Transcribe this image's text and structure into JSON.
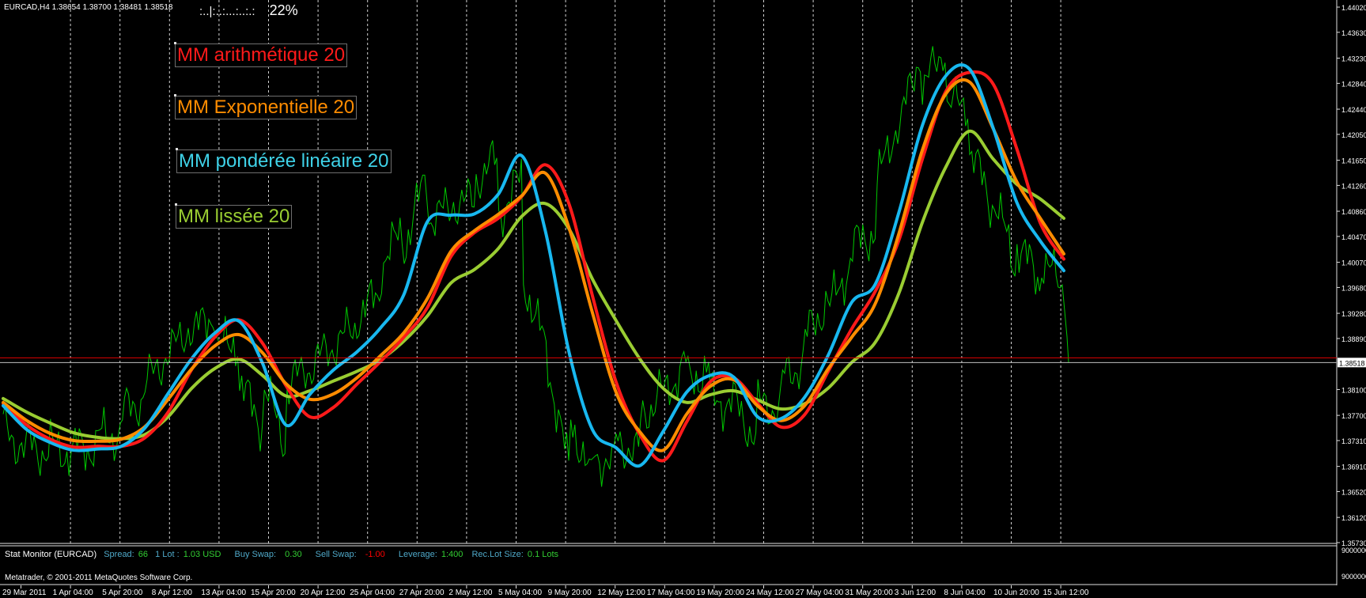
{
  "header": {
    "symbol_info": "EURCAD,H4  1.38654 1.38700 1.38481 1.38518",
    "progress_pattern": ":..|:..:...:..:.:",
    "progress_value": "22%"
  },
  "current_price_label": "1.38518",
  "lower_axis_labels": [
    "9000000",
    "9000000"
  ],
  "indicator_labels": {
    "sma": "MM arithmétique 20",
    "ema": "MM Exponentielle 20",
    "lwma": "MM pondérée linéaire 20",
    "smma": "MM lissée 20"
  },
  "stat_monitor": {
    "title": "Stat Monitor (EURCAD)",
    "spread_label": "Spread:",
    "spread_value": "66",
    "lot_label": "1 Lot :",
    "lot_value": "1.03 USD",
    "buy_swap_label": "Buy Swap:",
    "buy_swap_value": "0.30",
    "sell_swap_label": "Sell Swap:",
    "sell_swap_value": "-1.00",
    "leverage_label": "Leverage:",
    "leverage_value": "1:400",
    "reclot_label": "Rec.Lot Size:",
    "reclot_value": "0.1 Lots"
  },
  "copyright": "Metatrader, © 2001-2011 MetaQuotes Software Corp.",
  "colors": {
    "background": "#000000",
    "price": "#00c800",
    "sma": "#ff1a1a",
    "ema": "#ff8c00",
    "lwma": "#18b8f0",
    "smma": "#9acd32",
    "bid_line": "#e00000",
    "grid": "#d0d0d0",
    "label_text": "#ffffff",
    "value_text": "#32cd32",
    "negative_text": "#ff0000"
  },
  "chart_data": {
    "type": "line",
    "title": "",
    "symbol": "EURCAD",
    "timeframe": "H4",
    "ylim": [
      1.3573,
      1.4402
    ],
    "y_ticks": [
      "1.44020",
      "1.43630",
      "1.43230",
      "1.42840",
      "1.42440",
      "1.42050",
      "1.41650",
      "1.41260",
      "1.40860",
      "1.40470",
      "1.40070",
      "1.39680",
      "1.39280",
      "1.38890",
      "1.38100",
      "1.37700",
      "1.37310",
      "1.36910",
      "1.36520",
      "1.36120",
      "1.35730"
    ],
    "x_ticks": [
      "29 Mar 2011",
      "1 Apr 04:00",
      "5 Apr 20:00",
      "8 Apr 12:00",
      "13 Apr 04:00",
      "15 Apr 20:00",
      "20 Apr 12:00",
      "25 Apr 04:00",
      "27 Apr 20:00",
      "2 May 12:00",
      "5 May 04:00",
      "9 May 20:00",
      "12 May 12:00",
      "17 May 04:00",
      "19 May 20:00",
      "24 May 12:00",
      "27 May 04:00",
      "31 May 20:00",
      "3 Jun 12:00",
      "8 Jun 04:00",
      "10 Jun 20:00",
      "15 Jun 12:00"
    ],
    "grid": true,
    "current_bid": 1.38518,
    "series": [
      {
        "name": "MM arithmétique 20",
        "color": "#ff1a1a",
        "values": [
          1.3788,
          1.3755,
          1.3733,
          1.3721,
          1.3722,
          1.3722,
          1.3735,
          1.3775,
          1.3841,
          1.3892,
          1.3918,
          1.3882,
          1.3816,
          1.3768,
          1.3782,
          1.3818,
          1.3853,
          1.3891,
          1.3937,
          1.4016,
          1.4053,
          1.4075,
          1.4109,
          1.4158,
          1.4098,
          1.3955,
          1.3822,
          1.3741,
          1.37,
          1.376,
          1.3822,
          1.3828,
          1.3789,
          1.3752,
          1.3771,
          1.3838,
          1.3904,
          1.3962,
          1.4041,
          1.4167,
          1.4272,
          1.4301,
          1.4283,
          1.4183,
          1.4068,
          1.4012
        ]
      },
      {
        "name": "MM Exponentielle 20",
        "color": "#ff8c00",
        "values": [
          1.379,
          1.3762,
          1.3742,
          1.3731,
          1.373,
          1.3733,
          1.3752,
          1.3795,
          1.3842,
          1.3878,
          1.3895,
          1.3867,
          1.3819,
          1.3795,
          1.3803,
          1.3828,
          1.3862,
          1.3898,
          1.3951,
          1.4024,
          1.4056,
          1.4081,
          1.411,
          1.4145,
          1.4061,
          1.3929,
          1.3806,
          1.3745,
          1.3716,
          1.3772,
          1.3815,
          1.3825,
          1.3785,
          1.3762,
          1.3785,
          1.3842,
          1.3891,
          1.3943,
          1.4051,
          1.4181,
          1.4268,
          1.4286,
          1.4214,
          1.4132,
          1.4075,
          1.402
        ]
      },
      {
        "name": "MM pondérée linéaire 20",
        "color": "#18b8f0",
        "values": [
          1.3785,
          1.3748,
          1.3728,
          1.3716,
          1.3718,
          1.3722,
          1.375,
          1.3804,
          1.3858,
          1.3898,
          1.3916,
          1.3851,
          1.3755,
          1.3802,
          1.384,
          1.3868,
          1.3905,
          1.3957,
          1.407,
          1.408,
          1.4082,
          1.4112,
          1.4172,
          1.4056,
          1.3869,
          1.3748,
          1.372,
          1.3692,
          1.3745,
          1.3806,
          1.3832,
          1.3829,
          1.3768,
          1.3765,
          1.3798,
          1.3863,
          1.3945,
          1.3973,
          1.4084,
          1.4219,
          1.4296,
          1.4306,
          1.4215,
          1.41,
          1.404,
          1.3994
        ]
      },
      {
        "name": "MM lissée 20",
        "color": "#9acd32",
        "values": [
          1.3796,
          1.3775,
          1.3758,
          1.3743,
          1.3736,
          1.3734,
          1.374,
          1.3768,
          1.3812,
          1.3843,
          1.3857,
          1.3832,
          1.38,
          1.3808,
          1.3823,
          1.3838,
          1.3856,
          1.3885,
          1.3924,
          1.3975,
          1.3996,
          1.4028,
          1.4078,
          1.4098,
          1.4059,
          1.3981,
          1.3917,
          1.3858,
          1.3812,
          1.379,
          1.3802,
          1.3808,
          1.3794,
          1.378,
          1.3788,
          1.3812,
          1.3852,
          1.3883,
          1.3959,
          1.4069,
          1.4155,
          1.421,
          1.4167,
          1.4128,
          1.4105,
          1.4075
        ]
      }
    ]
  }
}
